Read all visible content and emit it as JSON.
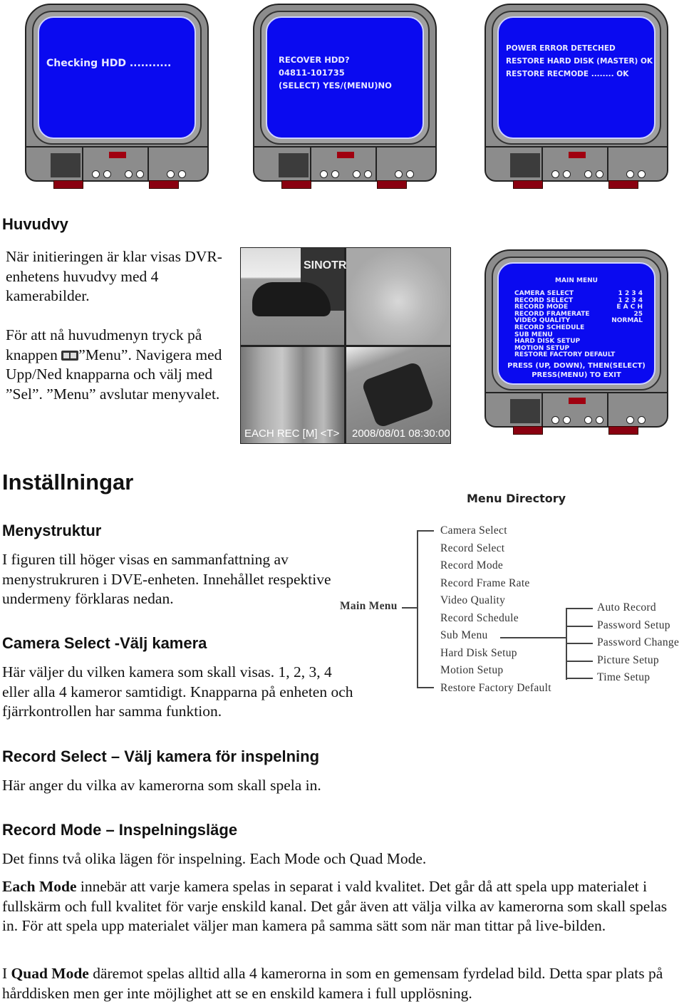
{
  "monitors": [
    {
      "lines": [
        "Checking HDD ..........."
      ]
    },
    {
      "lines": [
        "RECOVER HDD?",
        "04811-101735",
        "(SELECT) YES/(MENU)NO"
      ]
    },
    {
      "lines": [
        "POWER ERROR DETECHED",
        "RESTORE HARD DISK (MASTER) OK",
        "RESTORE RECMODE ........ OK"
      ]
    }
  ],
  "main_menu_screen": {
    "title": "MAIN MENU",
    "rows": [
      {
        "label": "CAMERA  SELECT",
        "value": "1 2 3 4"
      },
      {
        "label": "RECORD  SELECT",
        "value": "1 2 3 4"
      },
      {
        "label": "RECORD  MODE",
        "value": "E A C H"
      },
      {
        "label": "RECORD  FRAMERATE",
        "value": "25"
      },
      {
        "label": "VIDEO  QUALITY",
        "value": "NORMAL"
      },
      {
        "label": "RECORD  SCHEDULE",
        "value": ""
      },
      {
        "label": "SUB  MENU",
        "value": ""
      },
      {
        "label": "HARD  DISK  SETUP",
        "value": ""
      },
      {
        "label": "MOTION  SETUP",
        "value": ""
      },
      {
        "label": "RESTORE  FACTORY  DEFAULT",
        "value": ""
      }
    ],
    "footer1": "PRESS (UP, DOWN), THEN(SELECT)",
    "footer2": "PRESS(MENU)   TO  EXIT"
  },
  "camera_view": {
    "overlay_left": "EACH  REC  [M]  <T>",
    "overlay_right": "2008/08/01 08:30:00",
    "sign": "SINOTR"
  },
  "sections": {
    "huvudvy_title": "Huvudvy",
    "huvudvy_p1": "När initieringen är klar visas DVR-enhetens huvudvy med 4 kamerabilder.",
    "huvudvy_p2a": "För att nå huvudmenyn tryck på knappen ",
    "huvudvy_p2b": "”Menu”. Navigera med  Upp/Ned knapparna och välj med ”Sel”. ”Menu” avslutar menyvalet.",
    "installningar_title": "Inställningar",
    "menystruktur_title": "Menystruktur",
    "menystruktur_p": "I figuren till höger visas en sammanfattning av menystrukruren i DVE-enheten. Innehållet respektive undermeny förklaras nedan.",
    "camera_title": "Camera Select -Välj kamera",
    "camera_p": "Här väljer du vilken kamera som skall visas. 1, 2, 3, 4 eller alla 4 kameror samtidigt. Knapparna på enheten och fjärrkontrollen har samma funktion.",
    "record_select_title": "Record Select – Välj kamera för inspelning",
    "record_select_p": "Här anger du vilka av kamerorna som skall spela in.",
    "record_mode_title": "Record Mode – Inspelningsläge",
    "record_mode_p1": "Det finns två olika lägen för inspelning. Each Mode och Quad Mode.",
    "record_mode_p2_bold": "Each Mode",
    "record_mode_p2": " innebär att varje kamera spelas in separat i vald kvalitet. Det går då att spela upp materialet i fullskärm och full kvalitet för varje enskild kanal. Det går även att välja vilka av kamerorna som skall spelas in. För att spela upp materialet väljer man kamera på samma sätt som när man tittar på live-bilden.",
    "record_mode_p3_pre": "I ",
    "record_mode_p3_bold": "Quad Mode",
    "record_mode_p3": " däremot spelas alltid alla 4 kamerorna in som en gemensam fyrdelad bild. Detta spar plats på hårddisken men ger inte möjlighet att se en enskild kamera i full upplösning."
  },
  "menu_directory": {
    "title": "Menu  Directory",
    "root": "Main Menu",
    "items": [
      "Camera Select",
      "Record Select",
      "Record Mode",
      "Record Frame Rate",
      "Video Quality",
      "Record Schedule",
      "Sub Menu",
      "Hard Disk Setup",
      "Motion Setup",
      "Restore Factory Default"
    ],
    "sub_items": [
      "Auto Record",
      "Password Setup",
      "Password Change",
      "Picture Setup",
      "Time Setup"
    ]
  }
}
